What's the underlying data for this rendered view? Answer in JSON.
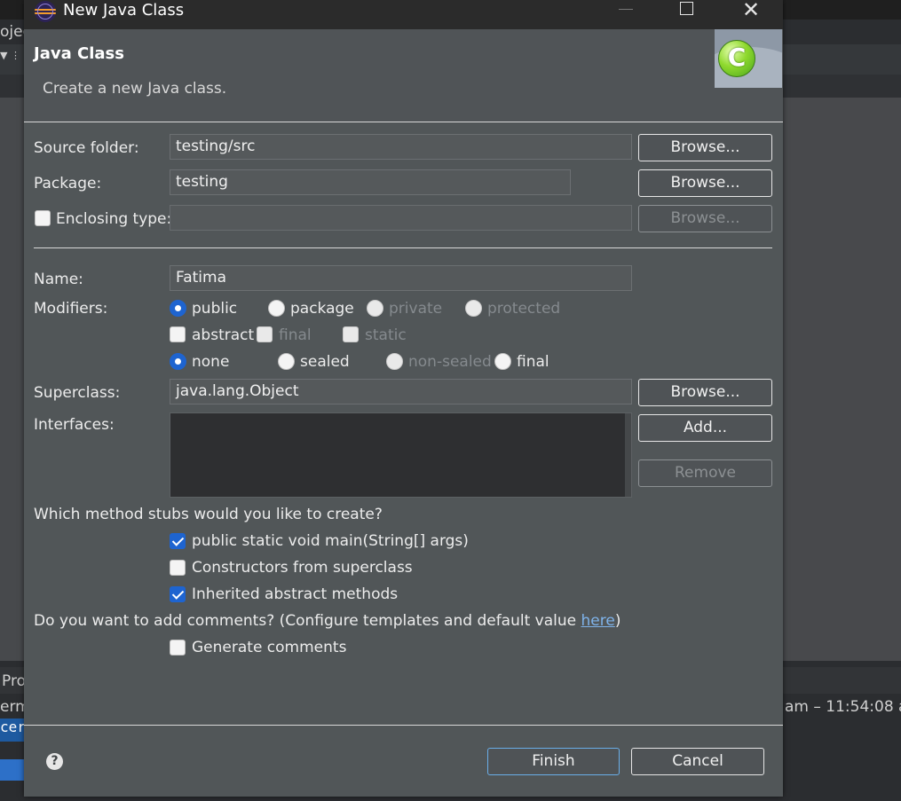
{
  "background": {
    "left_tab_fragment": "ojec",
    "bottom_tab_fragment": "Pro",
    "bottom_left_fragment": "erm",
    "bottom_left_selected": "cer",
    "status_time_fragment": "am – 11:54:08 am"
  },
  "dialog": {
    "title": "New Java Class",
    "header_title": "Java Class",
    "header_description": "Create a new Java class.",
    "class_icon_letter": "C",
    "source_folder": {
      "label": "Source folder:",
      "value": "testing/src",
      "browse": "Browse..."
    },
    "package": {
      "label": "Package:",
      "value": "testing",
      "browse": "Browse..."
    },
    "enclosing": {
      "label": "Enclosing type:",
      "value": "",
      "browse": "Browse..."
    },
    "name": {
      "label": "Name:",
      "value": "Fatima"
    },
    "modifiers": {
      "label": "Modifiers:",
      "access": [
        "public",
        "package",
        "private",
        "protected"
      ],
      "flags": [
        "abstract",
        "final",
        "static"
      ],
      "seal": [
        "none",
        "sealed",
        "non-sealed",
        "final"
      ]
    },
    "superclass": {
      "label": "Superclass:",
      "value": "java.lang.Object",
      "browse": "Browse..."
    },
    "interfaces": {
      "label": "Interfaces:",
      "add": "Add...",
      "remove": "Remove"
    },
    "stubs": {
      "question": "Which method stubs would you like to create?",
      "main": "public static void main(String[] args)",
      "constructors": "Constructors from superclass",
      "inherited": "Inherited abstract methods"
    },
    "comments": {
      "question": "Do you want to add comments? (Configure templates and default value",
      "link": "here",
      "close_paren": ")",
      "generate": "Generate comments"
    },
    "buttons": {
      "finish": "Finish",
      "cancel": "Cancel"
    },
    "colors": {
      "accent": "#1e64d0",
      "link": "#7fb3ea",
      "dialog_bg": "#515658"
    }
  }
}
